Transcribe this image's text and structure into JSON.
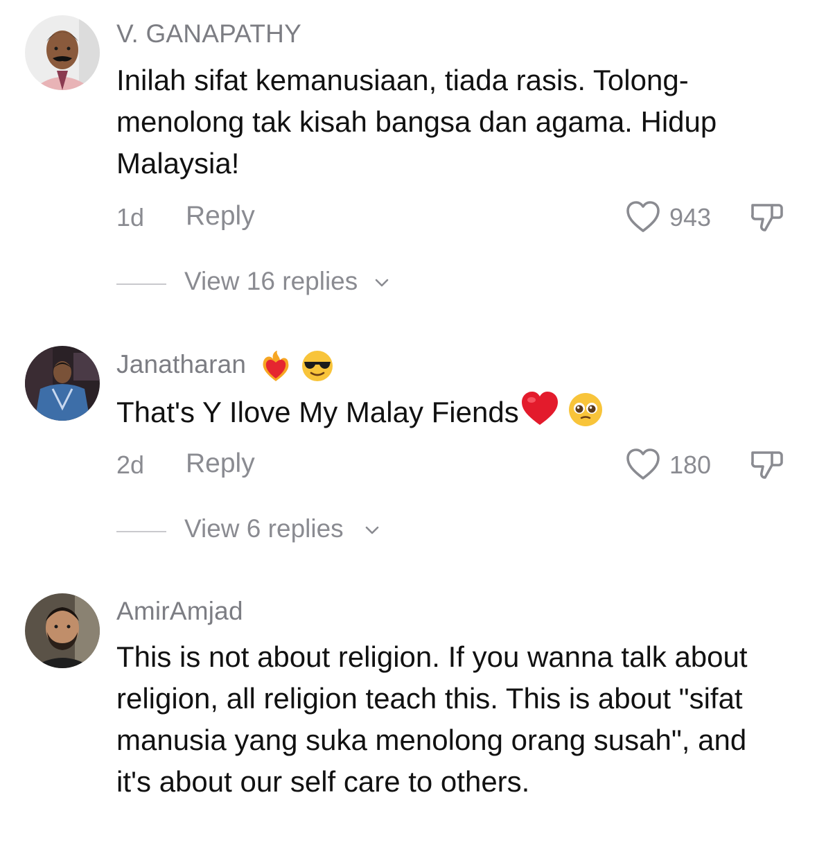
{
  "comments": [
    {
      "username": "V. GANAPATHY",
      "text": "Inilah sifat kemanusiaan, tiada rasis. Tolong-menolong tak kisah bangsa dan agama. Hidup Malaysia!",
      "age": "1d",
      "reply_label": "Reply",
      "like_count": "943",
      "view_replies": "View 16 replies",
      "avatar_icon": "avatar-man-mustache",
      "colors": {
        "skin": "#8a5a3c",
        "bg": "#f2f2f2"
      }
    },
    {
      "username": "Janatharan",
      "username_emojis": [
        "heart-on-fire-emoji",
        "sunglasses-emoji"
      ],
      "text": "That's Y Ilove My Malay Fiends",
      "text_emojis": [
        "red-heart-emoji",
        "pleading-face-emoji"
      ],
      "age": "2d",
      "reply_label": "Reply",
      "like_count": "180",
      "view_replies": "View 6 replies",
      "avatar_icon": "avatar-man-blue-jacket"
    },
    {
      "username": "AmirAmjad",
      "text": "This is not about religion. If you wanna talk about religion, all religion teach this. This is about \"sifat manusia yang suka menolong orang susah\", and it's about our self care to others.",
      "avatar_icon": "avatar-man-beard"
    }
  ],
  "colors": {
    "muted": "#8a8b91",
    "text": "#111111",
    "heart": "#e8202e"
  }
}
